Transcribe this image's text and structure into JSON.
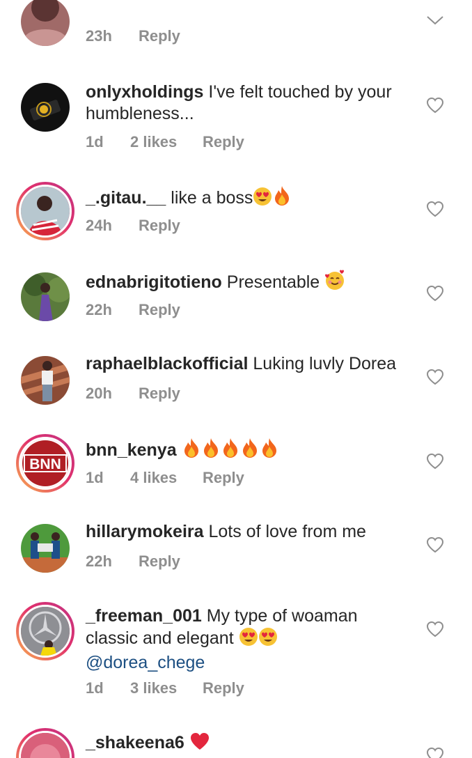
{
  "comments": [
    {
      "username": "",
      "text": "",
      "time": "23h",
      "likes": "",
      "reply_label": "Reply",
      "avatar_icon": "user-avatar-photo"
    },
    {
      "username": "onlyxholdings",
      "text": "I've felt touched by your humbleness...",
      "time": "1d",
      "likes": "2 likes",
      "reply_label": "Reply",
      "avatar_icon": "dark-device-avatar"
    },
    {
      "username": "_.gitau.__",
      "text": "like a boss",
      "emojis": [
        "heart-eyes-emoji",
        "fire-emoji"
      ],
      "time": "24h",
      "likes": "",
      "reply_label": "Reply",
      "avatar_icon": "user-avatar-photo",
      "has_story_ring": true
    },
    {
      "username": "ednabrigitotieno",
      "text": "Presentable",
      "emojis": [
        "smiling-face-with-hearts-emoji"
      ],
      "time": "22h",
      "likes": "",
      "reply_label": "Reply",
      "avatar_icon": "user-avatar-photo"
    },
    {
      "username": "raphaelblackofficial",
      "text": "Luking luvly Dorea",
      "time": "20h",
      "likes": "",
      "reply_label": "Reply",
      "avatar_icon": "user-avatar-photo"
    },
    {
      "username": "bnn_kenya",
      "text": "",
      "emojis": [
        "fire-emoji",
        "fire-emoji",
        "fire-emoji",
        "fire-emoji",
        "fire-emoji"
      ],
      "time": "1d",
      "likes": "4 likes",
      "reply_label": "Reply",
      "avatar_icon": "bnn-logo-avatar",
      "avatar_text": "BNN",
      "has_story_ring": true
    },
    {
      "username": "hillarymokeira",
      "text": "Lots of love from me",
      "time": "22h",
      "likes": "",
      "reply_label": "Reply",
      "avatar_icon": "user-avatar-photo"
    },
    {
      "username": "_freeman_001",
      "text": "My type of woaman classic and elegant",
      "emojis": [
        "heart-eyes-emoji",
        "heart-eyes-emoji"
      ],
      "mention": "@dorea_chege",
      "time": "1d",
      "likes": "3 likes",
      "reply_label": "Reply",
      "avatar_icon": "user-avatar-photo",
      "has_story_ring": true
    },
    {
      "username": "_shakeena6",
      "text": "",
      "emojis": [
        "red-heart-emoji"
      ],
      "time": "",
      "likes": "",
      "reply_label": "",
      "avatar_icon": "user-avatar-photo",
      "has_story_ring": true
    }
  ],
  "colors": {
    "text": "#262626",
    "meta": "#8e8e8e",
    "mention": "#1c4f82",
    "heart_outline": "#8e8e8e",
    "story_ring_start": "#f9b24f",
    "story_ring_end": "#c13584"
  }
}
